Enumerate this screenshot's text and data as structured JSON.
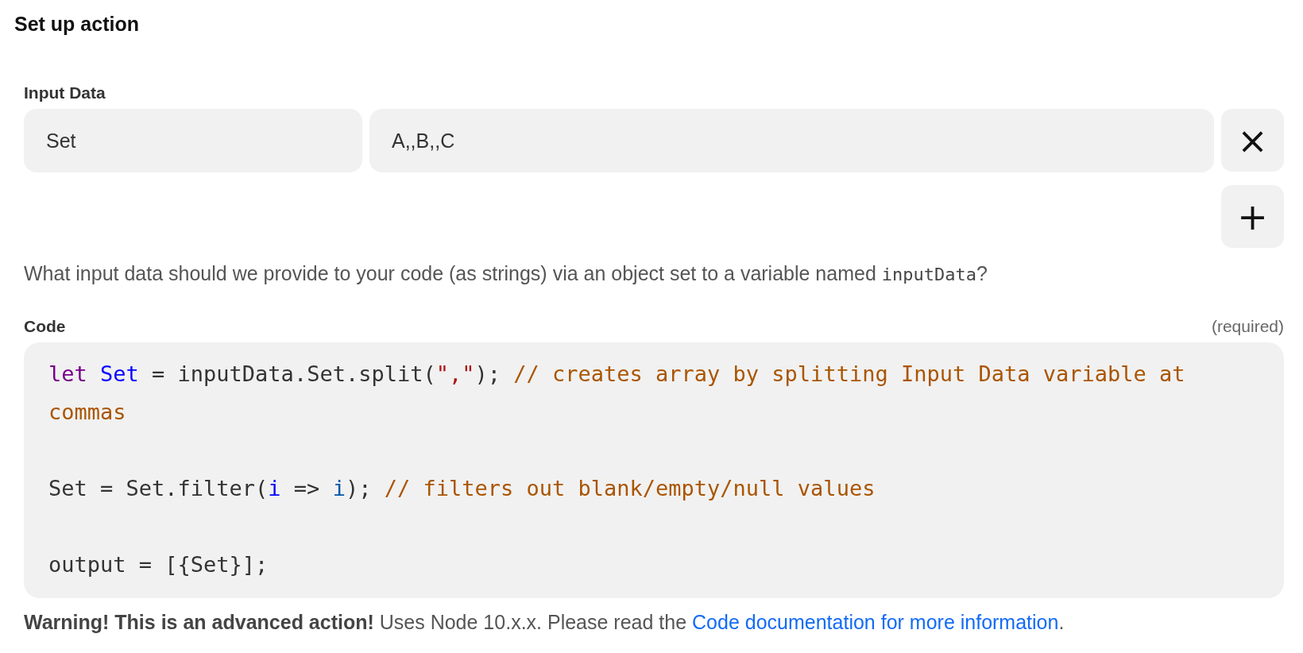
{
  "title": "Set up action",
  "input_data": {
    "label": "Input Data",
    "rows": [
      {
        "key": "Set",
        "value": "A,,B,,C"
      }
    ],
    "remove_symbol": "×",
    "add_symbol": "+"
  },
  "help": {
    "before": "What input data should we provide to your code (as strings) via an object set to a variable named ",
    "code": "inputData",
    "after": "?"
  },
  "code": {
    "label": "Code",
    "required": "(required)",
    "lines": [
      {
        "kind": "code",
        "tokens": [
          {
            "kind": "keyword",
            "text": "let "
          },
          {
            "kind": "def",
            "text": "Set"
          },
          {
            "kind": "plain",
            "text": " = inputData.Set.split("
          },
          {
            "kind": "string",
            "text": "\",\""
          },
          {
            "kind": "plain",
            "text": "); "
          },
          {
            "kind": "comment",
            "text": "// creates array by splitting Input Data variable at commas"
          }
        ]
      },
      {
        "kind": "blank"
      },
      {
        "kind": "code",
        "tokens": [
          {
            "kind": "plain",
            "text": "Set = Set.filter("
          },
          {
            "kind": "def",
            "text": "i"
          },
          {
            "kind": "plain",
            "text": " => "
          },
          {
            "kind": "variable",
            "text": "i"
          },
          {
            "kind": "plain",
            "text": "); "
          },
          {
            "kind": "comment",
            "text": "// filters out blank/empty/null values"
          }
        ]
      },
      {
        "kind": "blank"
      },
      {
        "kind": "code",
        "tokens": [
          {
            "kind": "plain",
            "text": "output = [{Set}];"
          }
        ]
      }
    ]
  },
  "warning": {
    "text": "**Warning! This is an advanced action!** Uses Node 10.x.x. Please read the ",
    "link": "Code documentation for more information",
    "after": "."
  }
}
